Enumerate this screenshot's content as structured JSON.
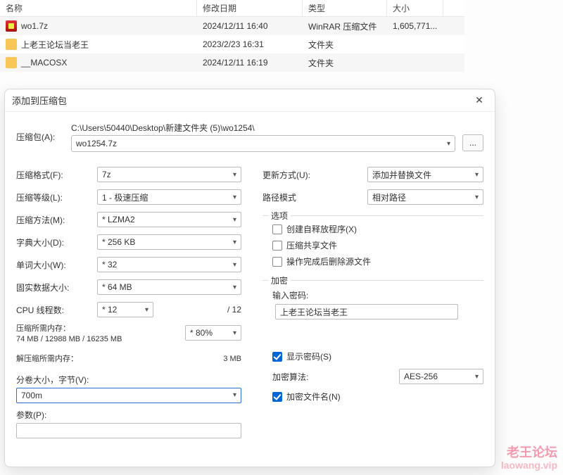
{
  "fileList": {
    "headers": {
      "name": "名称",
      "date": "修改日期",
      "type": "类型",
      "size": "大小"
    },
    "rows": [
      {
        "name": "wo1.7z",
        "date": "2024/12/11 16:40",
        "type": "WinRAR 压缩文件",
        "size": "1,605,771...",
        "icon": "archive"
      },
      {
        "name": "上老王论坛当老王",
        "date": "2023/2/23 16:31",
        "type": "文件夹",
        "size": "",
        "icon": "folder"
      },
      {
        "name": "__MACOSX",
        "date": "2024/12/11 16:19",
        "type": "文件夹",
        "size": "",
        "icon": "folder"
      }
    ]
  },
  "dialog": {
    "title": "添加到压缩包",
    "archiveLabel": "压缩包(A):",
    "archivePath": "C:\\Users\\50440\\Desktop\\新建文件夹 (5)\\wo1254\\",
    "archiveName": "wo1254.7z",
    "browse": "..."
  },
  "left": {
    "formatLabel": "压缩格式(F):",
    "format": "7z",
    "levelLabel": "压缩等级(L):",
    "level": "1 - 极速压缩",
    "methodLabel": "压缩方法(M):",
    "method": "* LZMA2",
    "dictLabel": "字典大小(D):",
    "dict": "* 256 KB",
    "wordLabel": "单词大小(W):",
    "word": "* 32",
    "solidLabel": "固实数据大小:",
    "solid": "* 64 MB",
    "threadsLabel": "CPU 线程数:",
    "threads": "* 12",
    "threadsMax": "/ 12",
    "memCompLabel": "压缩所需内存：",
    "memCompValue": "* 80%",
    "memCompDetail": "74 MB / 12988 MB / 16235 MB",
    "memDecompLabel": "解压缩所需内存：",
    "memDecompValue": "3 MB",
    "splitLabel": "分卷大小，字节(V):",
    "split": "700m",
    "paramsLabel": "参数(P):",
    "params": ""
  },
  "right": {
    "updateLabel": "更新方式(U):",
    "update": "添加并替换文件",
    "pathModeLabel": "路径模式",
    "pathMode": "相对路径",
    "optionsLegend": "选项",
    "sfx": "创建自释放程序(X)",
    "shared": "压缩共享文件",
    "deleteAfter": "操作完成后删除源文件",
    "encryptLegend": "加密",
    "pwdLabel": "输入密码:",
    "pwd": "上老王论坛当老王",
    "showPwd": "显示密码(S)",
    "algoLabel": "加密算法:",
    "algo": "AES-256",
    "encryptNames": "加密文件名(N)"
  },
  "watermark": {
    "line1": "老王论坛",
    "line2": "laowang.vip"
  }
}
